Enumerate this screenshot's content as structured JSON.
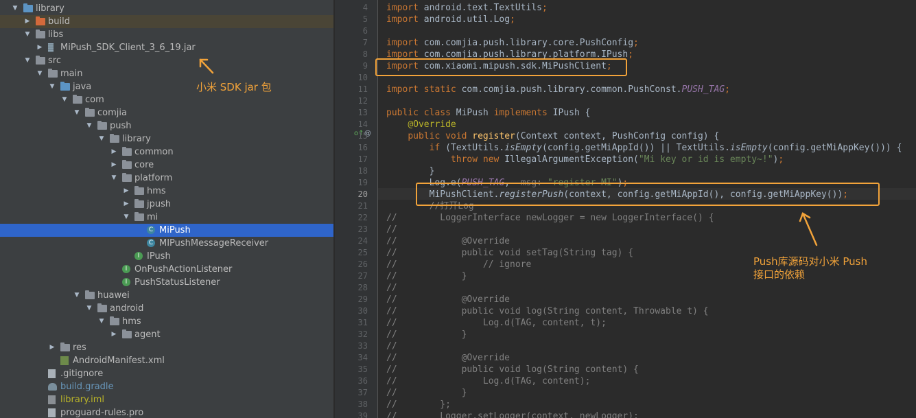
{
  "project_tree": {
    "items": [
      {
        "label": "library",
        "depth": 0,
        "expanded": true,
        "icon": "module-folder-icon"
      },
      {
        "label": "build",
        "depth": 1,
        "expanded": false,
        "icon": "folder-orange-icon",
        "style": "excluded"
      },
      {
        "label": "libs",
        "depth": 1,
        "expanded": true,
        "icon": "folder-icon"
      },
      {
        "label": "MiPush_SDK_Client_3_6_19.jar",
        "depth": 2,
        "expanded": false,
        "icon": "jar-icon"
      },
      {
        "label": "src",
        "depth": 1,
        "expanded": true,
        "icon": "folder-icon"
      },
      {
        "label": "main",
        "depth": 2,
        "expanded": true,
        "icon": "folder-icon"
      },
      {
        "label": "java",
        "depth": 3,
        "expanded": true,
        "icon": "folder-blue-icon"
      },
      {
        "label": "com",
        "depth": 4,
        "expanded": true,
        "icon": "package-icon"
      },
      {
        "label": "comjia",
        "depth": 5,
        "expanded": true,
        "icon": "package-icon"
      },
      {
        "label": "push",
        "depth": 6,
        "expanded": true,
        "icon": "package-icon"
      },
      {
        "label": "library",
        "depth": 7,
        "expanded": true,
        "icon": "package-icon"
      },
      {
        "label": "common",
        "depth": 8,
        "expanded": false,
        "icon": "package-icon"
      },
      {
        "label": "core",
        "depth": 8,
        "expanded": false,
        "icon": "package-icon"
      },
      {
        "label": "platform",
        "depth": 8,
        "expanded": true,
        "icon": "package-icon"
      },
      {
        "label": "hms",
        "depth": 9,
        "expanded": false,
        "icon": "package-icon"
      },
      {
        "label": "jpush",
        "depth": 9,
        "expanded": false,
        "icon": "package-icon"
      },
      {
        "label": "mi",
        "depth": 9,
        "expanded": true,
        "icon": "package-icon"
      },
      {
        "label": "MiPush",
        "depth": 10,
        "icon": "class-icon",
        "selected": true
      },
      {
        "label": "MIPushMessageReceiver",
        "depth": 10,
        "icon": "class-icon"
      },
      {
        "label": "IPush",
        "depth": 9,
        "icon": "interface-icon"
      },
      {
        "label": "OnPushActionListener",
        "depth": 8,
        "icon": "interface-icon"
      },
      {
        "label": "PushStatusListener",
        "depth": 8,
        "icon": "interface-icon"
      },
      {
        "label": "huawei",
        "depth": 5,
        "expanded": true,
        "icon": "package-icon"
      },
      {
        "label": "android",
        "depth": 6,
        "expanded": true,
        "icon": "package-icon"
      },
      {
        "label": "hms",
        "depth": 7,
        "expanded": true,
        "icon": "package-icon"
      },
      {
        "label": "agent",
        "depth": 8,
        "expanded": false,
        "icon": "package-icon"
      },
      {
        "label": "res",
        "depth": 3,
        "expanded": false,
        "icon": "res-folder-icon"
      },
      {
        "label": "AndroidManifest.xml",
        "depth": 3,
        "icon": "xml-file-icon"
      },
      {
        "label": ".gitignore",
        "depth": 2,
        "icon": "file-icon"
      },
      {
        "label": "build.gradle",
        "depth": 2,
        "icon": "gradle-icon",
        "style": "blue"
      },
      {
        "label": "library.iml",
        "depth": 2,
        "icon": "iml-icon",
        "style": "yellow"
      },
      {
        "label": "proguard-rules.pro",
        "depth": 2,
        "icon": "file-icon"
      }
    ]
  },
  "editor": {
    "current_line": 20,
    "lines": [
      {
        "n": 4,
        "code": "import android.text.TextUtils;"
      },
      {
        "n": 5,
        "code": "import android.util.Log;"
      },
      {
        "n": 6,
        "code": ""
      },
      {
        "n": 7,
        "code": "import com.comjia.push.library.core.PushConfig;"
      },
      {
        "n": 8,
        "code": "import com.comjia.push.library.platform.IPush;"
      },
      {
        "n": 9,
        "code": "import com.xiaomi.mipush.sdk.MiPushClient;"
      },
      {
        "n": 10,
        "code": ""
      },
      {
        "n": 11,
        "code": "import static com.comjia.push.library.common.PushConst.PUSH_TAG;"
      },
      {
        "n": 12,
        "code": ""
      },
      {
        "n": 13,
        "code": "public class MiPush implements IPush {"
      },
      {
        "n": 14,
        "code": "    @Override"
      },
      {
        "n": 15,
        "code": "    public void register(Context context, PushConfig config) {"
      },
      {
        "n": 16,
        "code": "        if (TextUtils.isEmpty(config.getMiAppId()) || TextUtils.isEmpty(config.getMiAppKey())) {"
      },
      {
        "n": 17,
        "code": "            throw new IllegalArgumentException(\"Mi key or id is empty~!\");"
      },
      {
        "n": 18,
        "code": "        }"
      },
      {
        "n": 19,
        "code": "        Log.e(PUSH_TAG,  msg: \"register MI\");"
      },
      {
        "n": 20,
        "code": "        MiPushClient.registerPush(context, config.getMiAppId(), config.getMiAppKey());"
      },
      {
        "n": 21,
        "code": "        //打开Log"
      },
      {
        "n": 22,
        "code": "//        LoggerInterface newLogger = new LoggerInterface() {"
      },
      {
        "n": 23,
        "code": "//"
      },
      {
        "n": 24,
        "code": "//            @Override"
      },
      {
        "n": 25,
        "code": "//            public void setTag(String tag) {"
      },
      {
        "n": 26,
        "code": "//                // ignore"
      },
      {
        "n": 27,
        "code": "//            }"
      },
      {
        "n": 28,
        "code": "//"
      },
      {
        "n": 29,
        "code": "//            @Override"
      },
      {
        "n": 30,
        "code": "//            public void log(String content, Throwable t) {"
      },
      {
        "n": 31,
        "code": "//                Log.d(TAG, content, t);"
      },
      {
        "n": 32,
        "code": "//            }"
      },
      {
        "n": 33,
        "code": "//"
      },
      {
        "n": 34,
        "code": "//            @Override"
      },
      {
        "n": 35,
        "code": "//            public void log(String content) {"
      },
      {
        "n": 36,
        "code": "//                Log.d(TAG, content);"
      },
      {
        "n": 37,
        "code": "//            }"
      },
      {
        "n": 38,
        "code": "//        };"
      },
      {
        "n": 39,
        "code": "//        Logger.setLogger(context, newLogger);"
      }
    ]
  },
  "annotations": {
    "jar_note": "小米 SDK jar 包",
    "dependency_note_line1": "Push库源码对小米 Push",
    "dependency_note_line2": "接口的依赖",
    "color": "#f2a33a"
  },
  "gutter_marks": {
    "override_marker": "o↑",
    "annotation_marker": "@"
  },
  "colors": {
    "tree_bg": "#3c3f41",
    "editor_bg": "#2b2b2b",
    "selection": "#2f65ca",
    "keyword": "#cc7832",
    "string": "#6a8759",
    "method": "#ffc66d",
    "comment": "#808080"
  }
}
